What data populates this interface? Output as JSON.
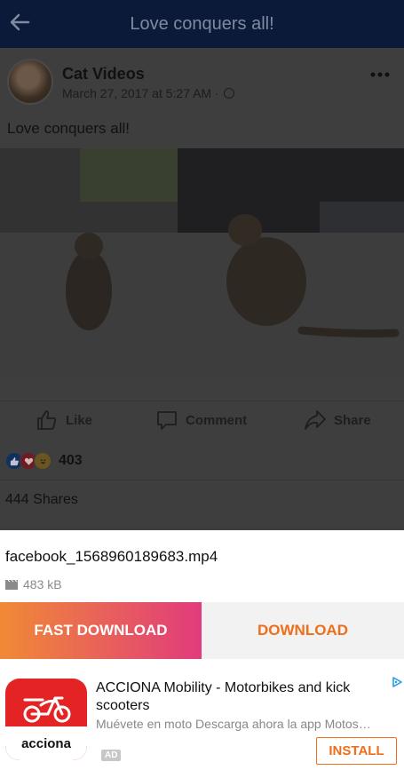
{
  "topbar": {
    "title": "Love conquers all!",
    "back_icon": "arrow-left-icon"
  },
  "post": {
    "page_name": "Cat Videos",
    "date": "March 27, 2017 at 5:27 AM ·",
    "caption": "Love conquers all!",
    "actions": [
      {
        "label": "Like",
        "icon": "thumbs-up-icon"
      },
      {
        "label": "Comment",
        "icon": "comment-icon"
      },
      {
        "label": "Share",
        "icon": "share-icon"
      }
    ],
    "reactions": {
      "icons": [
        "like-reaction-icon",
        "love-reaction-icon",
        "haha-reaction-icon"
      ],
      "count": "403"
    },
    "shares": "444 Shares"
  },
  "download": {
    "file_name": "facebook_1568960189683.mp4",
    "file_size": "483 kB",
    "fast_download_label": "FAST DOWNLOAD",
    "download_label": "DOWNLOAD"
  },
  "ad": {
    "title": "ACCIONA Mobility - Motorbikes and kick scooters",
    "description": "Muévete en moto Descarga ahora la app Motos…",
    "badge": "AD",
    "install_label": "INSTALL",
    "logo_text": "acciona"
  },
  "colors": {
    "topbar": "#0b1a38",
    "overlay_background": "#3e3e3e",
    "accent_orange": "#ee6e1c",
    "gradient_start": "#f08a36",
    "gradient_end": "#e13b7c",
    "ad_red": "#e42325"
  }
}
